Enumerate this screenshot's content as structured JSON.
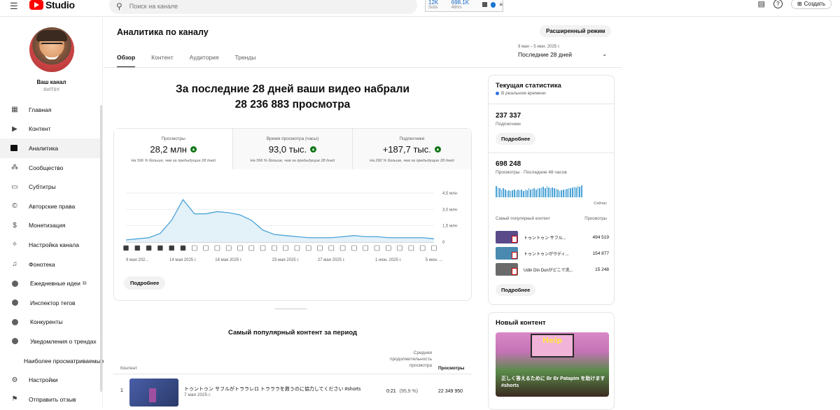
{
  "topbar": {
    "logo_text": "Studio",
    "search_placeholder": "Поиск на канале",
    "ext_subs": "12K",
    "ext_views": "698.1K",
    "ext_sub1": "Subs",
    "ext_sub2": "48hrs",
    "create_label": "Создать"
  },
  "channel": {
    "name": "Ваш канал",
    "handle": "SVITSY"
  },
  "sidebar": {
    "items": [
      {
        "label": "Главная",
        "icon": "dashboard-icon"
      },
      {
        "label": "Контент",
        "icon": "content-icon"
      },
      {
        "label": "Аналитика",
        "icon": "analytics-icon"
      },
      {
        "label": "Сообщество",
        "icon": "community-icon"
      },
      {
        "label": "Субтитры",
        "icon": "subtitles-icon"
      },
      {
        "label": "Авторские права",
        "icon": "copyright-icon"
      },
      {
        "label": "Монетизация",
        "icon": "monetization-icon"
      },
      {
        "label": "Настройка канала",
        "icon": "customization-icon"
      },
      {
        "label": "Фонотека",
        "icon": "audio-library-icon"
      },
      {
        "label": "Ежедневные идеи",
        "icon": "ext-icon"
      },
      {
        "label": "Инспектор тегов",
        "icon": "ext-icon"
      },
      {
        "label": "Конкуренты",
        "icon": "ext-icon"
      },
      {
        "label": "Уведомления о трендах",
        "icon": "ext-icon"
      },
      {
        "label": "Наиболее просматриваемые",
        "icon": "ext-icon"
      },
      {
        "label": "Настройки",
        "icon": "settings-icon"
      },
      {
        "label": "Отправить отзыв",
        "icon": "feedback-icon"
      }
    ]
  },
  "main": {
    "title": "Аналитика по каналу",
    "advanced_label": "Расширенный режим",
    "tabs": [
      "Обзор",
      "Контент",
      "Аудитория",
      "Тренды"
    ],
    "date_sub": "9 мая – 5 июн. 2025 г.",
    "date_main": "Последние 28 дней",
    "headline_line1": "За последние 28 дней ваши видео набрали",
    "headline_line2": "28 236 883 просмотра",
    "metrics": [
      {
        "label": "Просмотры",
        "value": "28,2 млн",
        "note": "На 596 % больше, чем за предыдущие 28 дней"
      },
      {
        "label": "Время просмотра (часы)",
        "value": "93,0 тыс.",
        "note": "На 596 % больше, чем за предыдущие 28 дней"
      },
      {
        "label": "Подписчики",
        "value": "+187,7 тыс.",
        "note": "На 282 % больше, чем за предыдущие 28 дней"
      }
    ],
    "more_label": "Подробнее",
    "top_content_title": "Самый популярный контент за период",
    "table": {
      "col_content": "Контент",
      "col_avg": "Средняя продолжительность просмотра",
      "col_views": "Просмотры",
      "rows": [
        {
          "num": "1",
          "title": "トゥントゥン サフルがトララレロ トラララを救うのに協力してください #shorts",
          "date": "7 мая 2025 г.",
          "avg": "0:21",
          "avg_pct": "(95,9 %)",
          "views": "22 349 950"
        }
      ]
    }
  },
  "chart_data": {
    "type": "area",
    "x": [
      "9 мая 202...",
      "10",
      "11",
      "12",
      "13",
      "14 мая 2025 г.",
      "15",
      "16",
      "17",
      "18 мая 2025 г.",
      "19",
      "20",
      "21",
      "22",
      "23 мая 2025 г.",
      "24",
      "25",
      "26",
      "27 мая 2025 г.",
      "28",
      "29",
      "30",
      "31",
      "1 июн. 2025 г.",
      "2",
      "3",
      "4",
      "5 июн. ..."
    ],
    "values": [
      0.2,
      0.3,
      0.4,
      0.8,
      2.0,
      3.9,
      2.6,
      2.6,
      2.8,
      2.7,
      2.5,
      2.0,
      1.1,
      0.7,
      0.6,
      0.5,
      0.4,
      0.4,
      0.4,
      0.5,
      0.6,
      0.5,
      0.5,
      0.4,
      0.4,
      0.4,
      0.4,
      0.3
    ],
    "xticks": [
      "9 мая 202...",
      "14 мая 2025 г.",
      "18 мая 2025 г.",
      "23 мая 2025 г.",
      "27 мая 2025 г.",
      "1 июн. 2025 г.",
      "5 июн. ..."
    ],
    "yticks": [
      "0",
      "1,5 млн",
      "3,0 млн",
      "4,5 млн"
    ],
    "ylim": [
      0,
      4.5
    ],
    "series_color": "#4ba3d6",
    "fill_color": "#e3f1f9"
  },
  "realtime": {
    "title": "Текущая статистика",
    "live": "В реальном времени",
    "subs_value": "237 337",
    "subs_label": "Подписчики",
    "more1": "Подробнее",
    "views_value": "698 248",
    "views_label": "Просмотры · Последние 48 часов",
    "now_label": "Сейчас",
    "top_header": "Самый популярный контент",
    "top_views_header": "Просмотры",
    "top": [
      {
        "title": "トゥントゥン サフル...",
        "views": "494 519",
        "color": "#5a4a8a"
      },
      {
        "title": "トゥントゥンがウディ...",
        "views": "154 877",
        "color": "#4a8ab0"
      },
      {
        "title": "Udin Din Dunがどこで洗...",
        "views": "15 248",
        "color": "#6a6a6a"
      }
    ],
    "more2": "Подробнее",
    "bars": [
      0.9,
      0.8,
      0.7,
      0.6,
      0.7,
      0.6,
      0.5,
      0.55,
      0.5,
      0.55,
      0.6,
      0.5,
      0.6,
      0.55,
      0.6,
      0.5,
      0.6,
      0.55,
      0.7,
      0.6,
      0.65,
      0.7,
      0.6,
      0.75,
      0.7,
      0.8,
      0.85,
      0.7,
      0.9,
      0.8,
      0.75,
      0.8,
      0.7,
      0.65,
      0.6,
      0.5,
      0.55,
      0.6,
      0.6,
      0.65,
      0.7,
      0.75,
      0.8,
      0.85,
      0.8,
      0.9,
      0.85,
      0.95
    ]
  },
  "new_content": {
    "title": "Новый контент",
    "caption": "正しく答えるために Br Br Patapim を助けます #shorts",
    "sign": "Help"
  }
}
